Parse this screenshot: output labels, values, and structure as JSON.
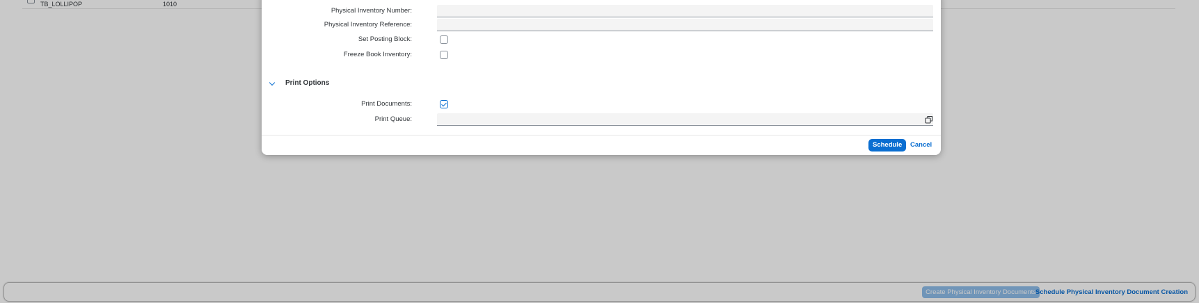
{
  "background": {
    "table_row": {
      "col1": "TB_LOLLIPOP",
      "col2": "1010"
    },
    "footer": {
      "create_button": "Create Physical Inventory Documents",
      "schedule_button": "Schedule Physical Inventory Document Creation"
    }
  },
  "dialog": {
    "fields": {
      "pi_number_label": "Physical Inventory Number:",
      "pi_number_value": "",
      "pi_reference_label": "Physical Inventory Reference:",
      "pi_reference_value": "",
      "posting_block_label": "Set Posting Block:",
      "posting_block_checked": false,
      "freeze_book_label": "Freeze Book Inventory:",
      "freeze_book_checked": false
    },
    "print_options": {
      "title": "Print Options",
      "print_documents_label": "Print Documents:",
      "print_documents_checked": true,
      "print_queue_label": "Print Queue:",
      "print_queue_value": ""
    },
    "footer": {
      "schedule_label": "Schedule",
      "cancel_label": "Cancel"
    }
  },
  "colors": {
    "accent": "#0a6ed1",
    "text": "#32363a",
    "overlay": "rgba(0,0,0,0.21)"
  },
  "icons": [
    "chevron-down-icon",
    "value-help-icon",
    "checkmark-icon"
  ]
}
